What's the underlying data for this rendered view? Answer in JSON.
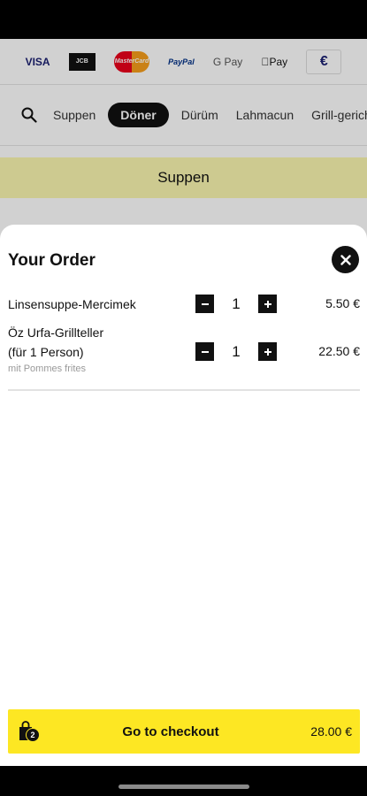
{
  "payment_methods": [
    {
      "name": "VISA",
      "icon": "visa-icon"
    },
    {
      "name": "JCB",
      "icon": "jcb-icon"
    },
    {
      "name": "MasterCard",
      "icon": "mastercard-icon"
    },
    {
      "name": "PayPal",
      "icon": "paypal-icon"
    },
    {
      "name": "G Pay",
      "icon": "google-pay-icon"
    },
    {
      "name": "Pay",
      "icon": "apple-pay-icon"
    },
    {
      "name": "€",
      "icon": "euro-icon"
    }
  ],
  "categories": [
    "Suppen",
    "Döner",
    "Dürüm",
    "Lahmacun",
    "Grill-gericht"
  ],
  "active_category": "Döner",
  "section_title": "Suppen",
  "order": {
    "title": "Your Order",
    "items": [
      {
        "name": "Linsensuppe-Mercimek",
        "name2": "",
        "note": "",
        "qty": "1",
        "price": "5.50 €"
      },
      {
        "name": "Öz Urfa-Grillteller",
        "name2": "(für 1 Person)",
        "note": "mit Pommes frites",
        "qty": "1",
        "price": "22.50 €"
      }
    ]
  },
  "checkout": {
    "label": "Go to checkout",
    "total": "28.00 €",
    "badge_count": "2"
  },
  "colors": {
    "accent": "#fde723",
    "dark": "#111111",
    "section_band": "#fbf7b0"
  }
}
